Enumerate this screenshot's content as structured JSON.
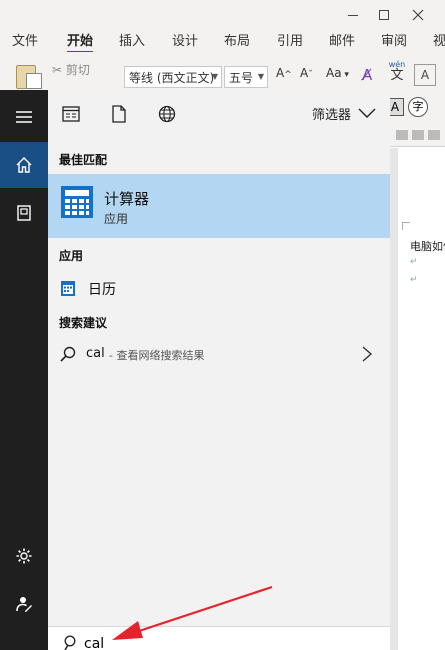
{
  "word": {
    "ribbon_tabs": [
      "文件",
      "开始",
      "插入",
      "设计",
      "布局",
      "引用",
      "邮件",
      "审阅",
      "视"
    ],
    "active_tab": "开始",
    "clipboard": {
      "cut_label": "剪切"
    },
    "font": {
      "family": "等线 (西文正文)",
      "size": "五号",
      "grow_label": "A",
      "shrink_label": "A",
      "case_label": "Aa",
      "phonetic_pinyin": "wén",
      "phonetic_char": "文",
      "char_border_label": "A",
      "enclosed_char_label": "字",
      "right_icon_label": "A"
    },
    "document": {
      "visible_text": "电脑如何"
    }
  },
  "start_menu": {
    "toolbar": {
      "filter_label": "筛选器"
    },
    "best_match": {
      "header": "最佳匹配",
      "title": "计算器",
      "subtitle": "应用"
    },
    "apps": {
      "header": "应用",
      "items": [
        {
          "label": "日历"
        }
      ]
    },
    "suggestions": {
      "header": "搜索建议",
      "items": [
        {
          "query": "cal",
          "hint": "- 查看网络搜索结果"
        }
      ]
    },
    "search": {
      "value": "cal"
    }
  },
  "colors": {
    "accent": "#1a4f86",
    "highlight": "#b3d7f2",
    "rail": "#1f1f1f",
    "arrow": "#e8222b",
    "word_accent": "#2b579a"
  }
}
